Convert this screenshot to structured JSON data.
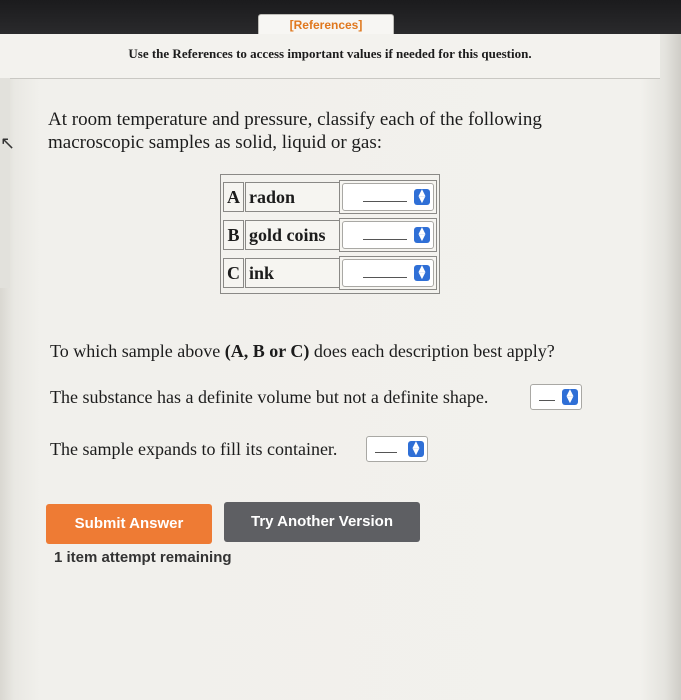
{
  "header": {
    "references_label": "[References]"
  },
  "instruction": "Use the References to access important values if needed for this question.",
  "question": "At room temperature and pressure, classify each of the following macroscopic samples as solid, liquid or gas:",
  "samples": [
    {
      "letter": "A",
      "name": "radon",
      "selected": ""
    },
    {
      "letter": "B",
      "name": "gold coins",
      "selected": ""
    },
    {
      "letter": "C",
      "name": "ink",
      "selected": ""
    }
  ],
  "part2": {
    "prompt_prefix": "To which sample above ",
    "prompt_bold": "(A, B or C)",
    "prompt_suffix": " does each description best apply?",
    "descriptions": [
      {
        "text": "The substance has a definite volume but not a definite shape.",
        "selected": ""
      },
      {
        "text": "The sample expands to fill its container.",
        "selected": ""
      }
    ]
  },
  "buttons": {
    "submit": "Submit Answer",
    "try_another": "Try Another Version"
  },
  "attempts_remaining": "1 item attempt remaining",
  "icons": {
    "side_arrow": "left-arrow-icon",
    "dropdown": "chevron-updown-icon"
  },
  "colors": {
    "submit": "#ee7b34",
    "try_another": "#5e5f63",
    "references": "#e0781e",
    "dropdown_arrow": "#2f6fd6"
  }
}
